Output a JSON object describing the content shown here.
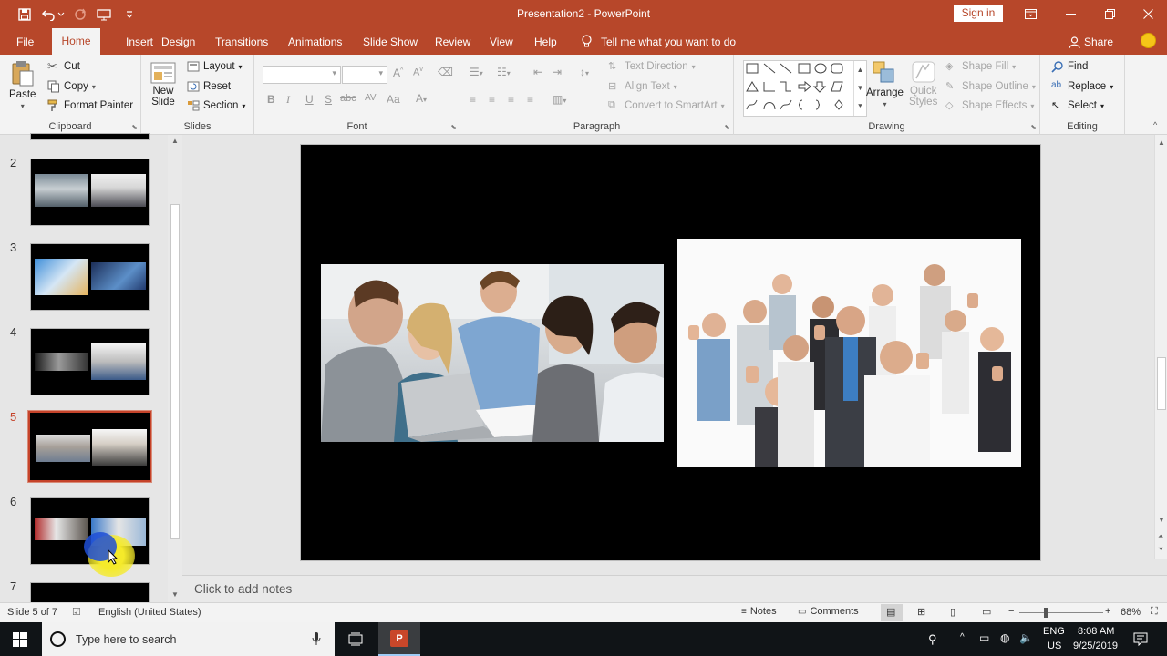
{
  "titlebar": {
    "document_title": "Presentation2 - PowerPoint",
    "sign_in": "Sign in",
    "quick_access": [
      "save-icon",
      "undo-icon",
      "redo-icon",
      "start-from-beginning-icon",
      "customize-icon"
    ]
  },
  "tabs": [
    "File",
    "Home",
    "Insert",
    "Design",
    "Transitions",
    "Animations",
    "Slide Show",
    "Review",
    "View",
    "Help"
  ],
  "tell_me": "Tell me what you want to do",
  "share": "Share",
  "ribbon": {
    "clipboard": {
      "paste": "Paste",
      "cut": "Cut",
      "copy": "Copy",
      "format_painter": "Format Painter",
      "label": "Clipboard"
    },
    "slides": {
      "new_slide_1": "New",
      "new_slide_2": "Slide",
      "layout": "Layout",
      "reset": "Reset",
      "section": "Section",
      "label": "Slides"
    },
    "font": {
      "label": "Font",
      "bold": "B",
      "italic": "I",
      "underline": "U",
      "shadow": "S",
      "strike": "abc",
      "case": "Aa"
    },
    "paragraph": {
      "text_direction": "Text Direction",
      "align_text": "Align Text",
      "convert_smartart": "Convert to SmartArt",
      "label": "Paragraph"
    },
    "drawing": {
      "arrange": "Arrange",
      "quick_styles_1": "Quick",
      "quick_styles_2": "Styles",
      "shape_fill": "Shape Fill",
      "shape_outline": "Shape Outline",
      "shape_effects": "Shape Effects",
      "label": "Drawing"
    },
    "editing": {
      "find": "Find",
      "replace": "Replace",
      "select": "Select",
      "label": "Editing"
    }
  },
  "slides_panel": {
    "numbers": [
      "2",
      "3",
      "4",
      "5",
      "6",
      "7"
    ],
    "selected": "5"
  },
  "notes_placeholder": "Click to add notes",
  "status": {
    "slide_counter": "Slide 5 of 7",
    "language": "English (United States)",
    "notes": "Notes",
    "comments": "Comments",
    "zoom": "68%"
  },
  "taskbar": {
    "search_placeholder": "Type here to search",
    "lang_1": "ENG",
    "lang_2": "US",
    "time": "8:08 AM",
    "date": "9/25/2019"
  },
  "colors": {
    "accent": "#b7472a",
    "selection": "#c5432a"
  }
}
